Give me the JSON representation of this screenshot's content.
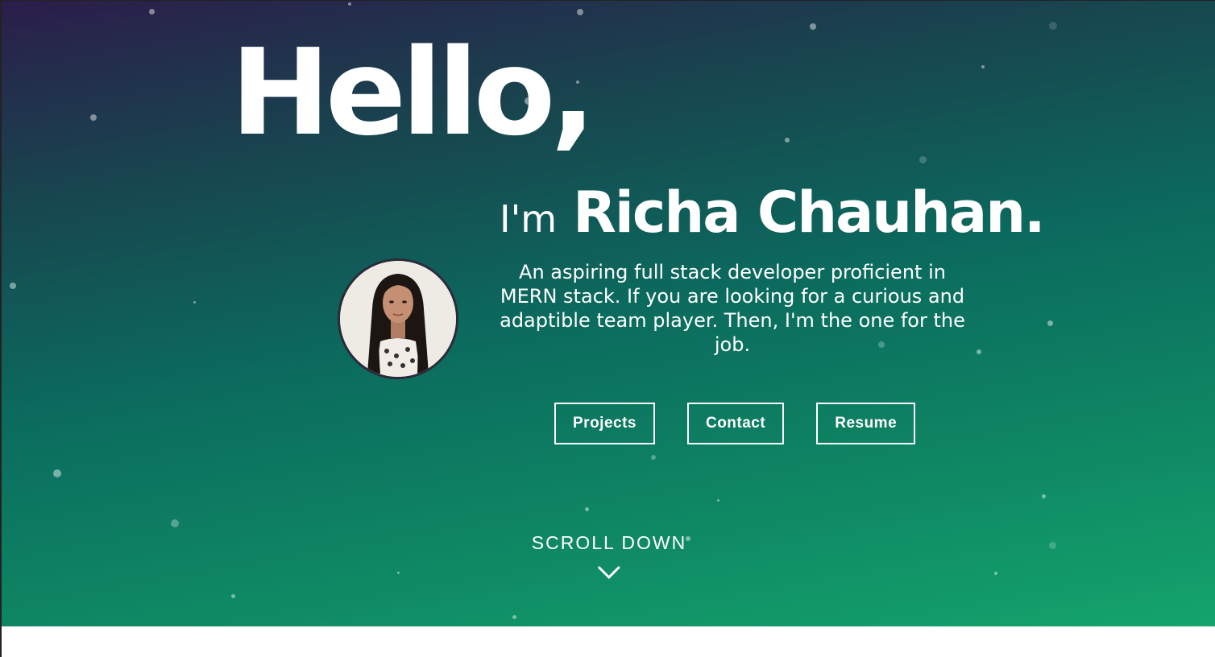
{
  "hero": {
    "greeting": "Hello,",
    "intro_prefix": "I'm",
    "name": "Richa Chauhan.",
    "bio": "An aspiring full stack developer proficient in MERN stack. If you are looking for a curious and adaptible team player. Then, I'm the one for the job."
  },
  "buttons": {
    "projects": "Projects",
    "contact": "Contact",
    "resume": "Resume"
  },
  "scroll": {
    "label": "SCROLL DOWN",
    "icon": "chevron-down-icon"
  },
  "colors": {
    "gradient_top": "#2b1d4a",
    "gradient_mid": "#0b6b5e",
    "gradient_bottom": "#14a46c",
    "text": "#ffffff"
  }
}
